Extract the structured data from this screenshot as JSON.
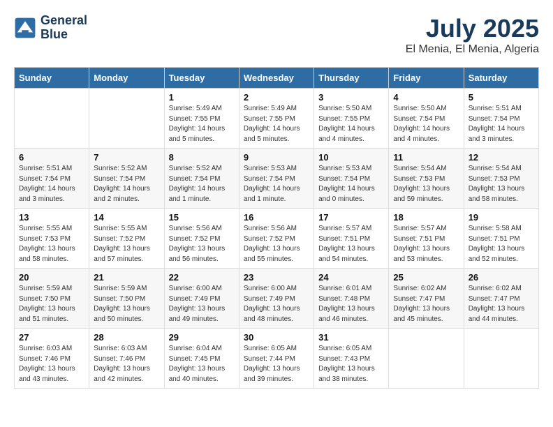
{
  "header": {
    "logo_line1": "General",
    "logo_line2": "Blue",
    "title": "July 2025",
    "subtitle": "El Menia, El Menia, Algeria"
  },
  "days_of_week": [
    "Sunday",
    "Monday",
    "Tuesday",
    "Wednesday",
    "Thursday",
    "Friday",
    "Saturday"
  ],
  "weeks": [
    [
      {
        "day": "",
        "info": ""
      },
      {
        "day": "",
        "info": ""
      },
      {
        "day": "1",
        "info": "Sunrise: 5:49 AM\nSunset: 7:55 PM\nDaylight: 14 hours\nand 5 minutes."
      },
      {
        "day": "2",
        "info": "Sunrise: 5:49 AM\nSunset: 7:55 PM\nDaylight: 14 hours\nand 5 minutes."
      },
      {
        "day": "3",
        "info": "Sunrise: 5:50 AM\nSunset: 7:55 PM\nDaylight: 14 hours\nand 4 minutes."
      },
      {
        "day": "4",
        "info": "Sunrise: 5:50 AM\nSunset: 7:54 PM\nDaylight: 14 hours\nand 4 minutes."
      },
      {
        "day": "5",
        "info": "Sunrise: 5:51 AM\nSunset: 7:54 PM\nDaylight: 14 hours\nand 3 minutes."
      }
    ],
    [
      {
        "day": "6",
        "info": "Sunrise: 5:51 AM\nSunset: 7:54 PM\nDaylight: 14 hours\nand 3 minutes."
      },
      {
        "day": "7",
        "info": "Sunrise: 5:52 AM\nSunset: 7:54 PM\nDaylight: 14 hours\nand 2 minutes."
      },
      {
        "day": "8",
        "info": "Sunrise: 5:52 AM\nSunset: 7:54 PM\nDaylight: 14 hours\nand 1 minute."
      },
      {
        "day": "9",
        "info": "Sunrise: 5:53 AM\nSunset: 7:54 PM\nDaylight: 14 hours\nand 1 minute."
      },
      {
        "day": "10",
        "info": "Sunrise: 5:53 AM\nSunset: 7:54 PM\nDaylight: 14 hours\nand 0 minutes."
      },
      {
        "day": "11",
        "info": "Sunrise: 5:54 AM\nSunset: 7:53 PM\nDaylight: 13 hours\nand 59 minutes."
      },
      {
        "day": "12",
        "info": "Sunrise: 5:54 AM\nSunset: 7:53 PM\nDaylight: 13 hours\nand 58 minutes."
      }
    ],
    [
      {
        "day": "13",
        "info": "Sunrise: 5:55 AM\nSunset: 7:53 PM\nDaylight: 13 hours\nand 58 minutes."
      },
      {
        "day": "14",
        "info": "Sunrise: 5:55 AM\nSunset: 7:52 PM\nDaylight: 13 hours\nand 57 minutes."
      },
      {
        "day": "15",
        "info": "Sunrise: 5:56 AM\nSunset: 7:52 PM\nDaylight: 13 hours\nand 56 minutes."
      },
      {
        "day": "16",
        "info": "Sunrise: 5:56 AM\nSunset: 7:52 PM\nDaylight: 13 hours\nand 55 minutes."
      },
      {
        "day": "17",
        "info": "Sunrise: 5:57 AM\nSunset: 7:51 PM\nDaylight: 13 hours\nand 54 minutes."
      },
      {
        "day": "18",
        "info": "Sunrise: 5:57 AM\nSunset: 7:51 PM\nDaylight: 13 hours\nand 53 minutes."
      },
      {
        "day": "19",
        "info": "Sunrise: 5:58 AM\nSunset: 7:51 PM\nDaylight: 13 hours\nand 52 minutes."
      }
    ],
    [
      {
        "day": "20",
        "info": "Sunrise: 5:59 AM\nSunset: 7:50 PM\nDaylight: 13 hours\nand 51 minutes."
      },
      {
        "day": "21",
        "info": "Sunrise: 5:59 AM\nSunset: 7:50 PM\nDaylight: 13 hours\nand 50 minutes."
      },
      {
        "day": "22",
        "info": "Sunrise: 6:00 AM\nSunset: 7:49 PM\nDaylight: 13 hours\nand 49 minutes."
      },
      {
        "day": "23",
        "info": "Sunrise: 6:00 AM\nSunset: 7:49 PM\nDaylight: 13 hours\nand 48 minutes."
      },
      {
        "day": "24",
        "info": "Sunrise: 6:01 AM\nSunset: 7:48 PM\nDaylight: 13 hours\nand 46 minutes."
      },
      {
        "day": "25",
        "info": "Sunrise: 6:02 AM\nSunset: 7:47 PM\nDaylight: 13 hours\nand 45 minutes."
      },
      {
        "day": "26",
        "info": "Sunrise: 6:02 AM\nSunset: 7:47 PM\nDaylight: 13 hours\nand 44 minutes."
      }
    ],
    [
      {
        "day": "27",
        "info": "Sunrise: 6:03 AM\nSunset: 7:46 PM\nDaylight: 13 hours\nand 43 minutes."
      },
      {
        "day": "28",
        "info": "Sunrise: 6:03 AM\nSunset: 7:46 PM\nDaylight: 13 hours\nand 42 minutes."
      },
      {
        "day": "29",
        "info": "Sunrise: 6:04 AM\nSunset: 7:45 PM\nDaylight: 13 hours\nand 40 minutes."
      },
      {
        "day": "30",
        "info": "Sunrise: 6:05 AM\nSunset: 7:44 PM\nDaylight: 13 hours\nand 39 minutes."
      },
      {
        "day": "31",
        "info": "Sunrise: 6:05 AM\nSunset: 7:43 PM\nDaylight: 13 hours\nand 38 minutes."
      },
      {
        "day": "",
        "info": ""
      },
      {
        "day": "",
        "info": ""
      }
    ]
  ]
}
